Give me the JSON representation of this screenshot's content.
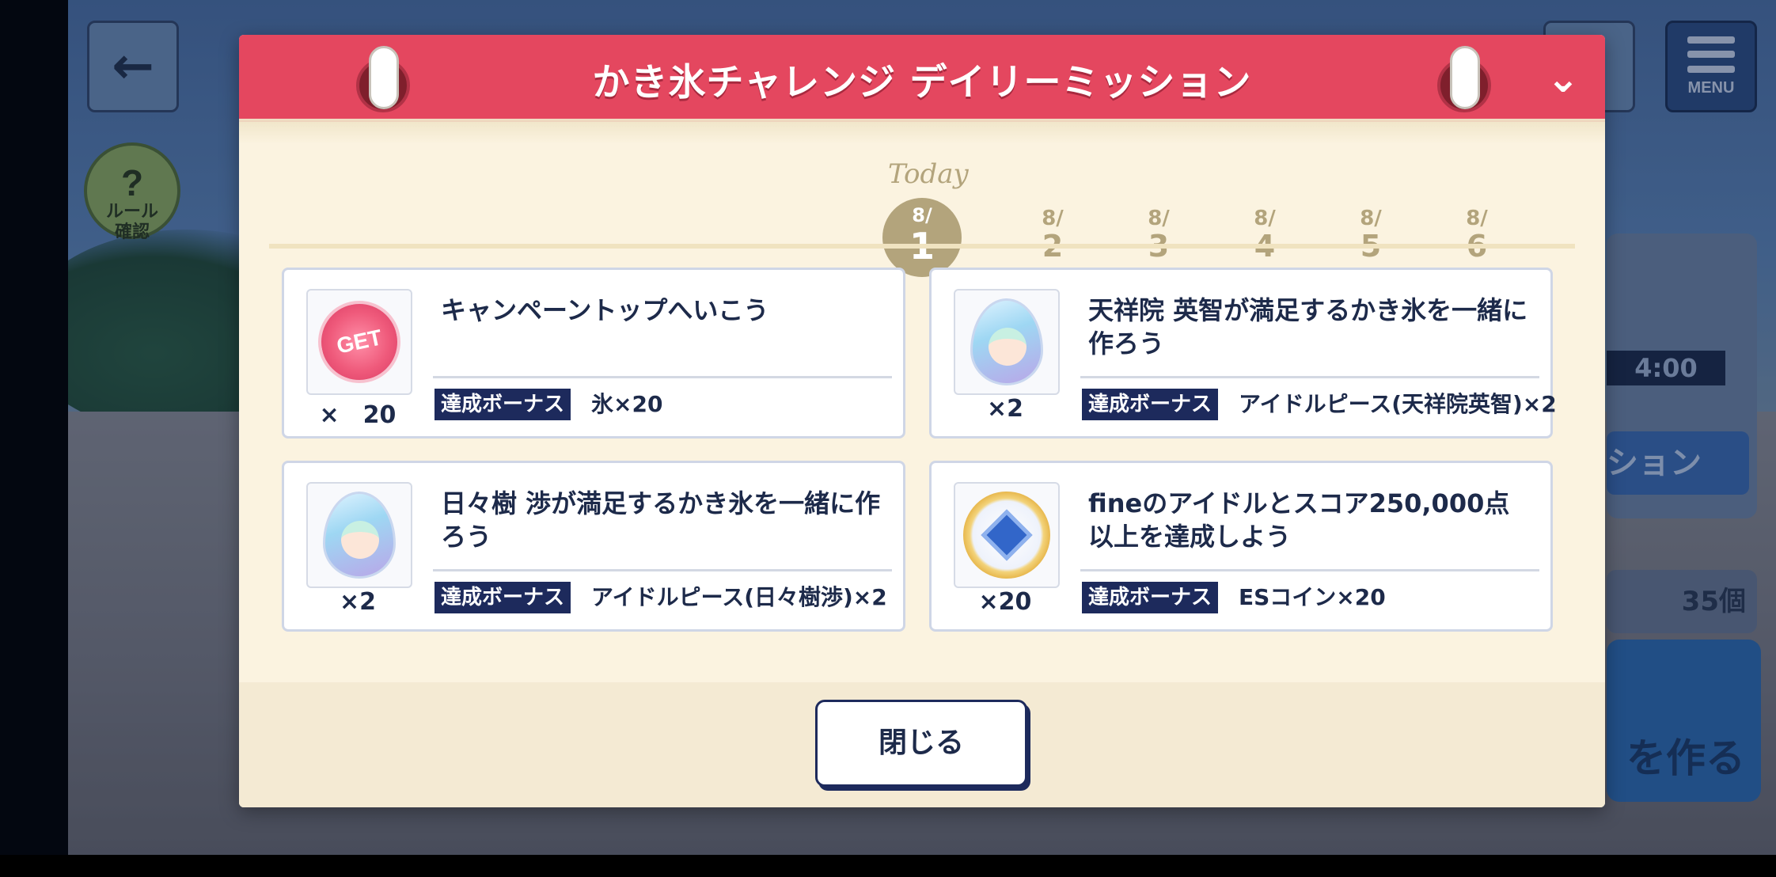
{
  "background": {
    "back_icon": "left-arrow-icon",
    "rule_button": {
      "icon": "question-icon",
      "label_line1": "ルール",
      "label_line2": "確認"
    },
    "menu_button": {
      "icon": "hamburger-icon",
      "label": "MENU"
    },
    "side_time": "4:00",
    "side_label": "ション",
    "side_count": "35個",
    "side_make_label": "を作る"
  },
  "dialog": {
    "title": "かき氷チャレンジ デイリーミッション",
    "collapse_icon": "chevron-down-icon",
    "today_label": "Today",
    "dates": [
      {
        "month": "8/",
        "day": "1",
        "today": true
      },
      {
        "month": "8/",
        "day": "2"
      },
      {
        "month": "8/",
        "day": "3"
      },
      {
        "month": "8/",
        "day": "4"
      },
      {
        "month": "8/",
        "day": "5"
      },
      {
        "month": "8/",
        "day": "6"
      }
    ],
    "missions": [
      {
        "icon": "get-ticket-icon",
        "icon_text": "GET",
        "quantity": "×　20",
        "title": "キャンペーントップへいこう",
        "bonus_tag": "達成ボーナス",
        "bonus": "氷×20"
      },
      {
        "icon": "idol-piece-eichi-icon",
        "quantity": "×2",
        "title": "天祥院 英智が満足するかき氷を一緒に作ろう",
        "bonus_tag": "達成ボーナス",
        "bonus": "アイドルピース(天祥院英智)×2"
      },
      {
        "icon": "idol-piece-wataru-icon",
        "quantity": "×2",
        "title": "日々樹 渉が満足するかき氷を一緒に作ろう",
        "bonus_tag": "達成ボーナス",
        "bonus": "アイドルピース(日々樹渉)×2"
      },
      {
        "icon": "es-coin-icon",
        "quantity": "×20",
        "title": "fineのアイドルとスコア250,000点以上を達成しよう",
        "bonus_tag": "達成ボーナス",
        "bonus": "ESコイン×20"
      }
    ],
    "close_label": "閉じる"
  },
  "colors": {
    "header": "#e4475f",
    "navy": "#1d2a5c",
    "gold": "#b3a47c",
    "cream": "#fbf3e0"
  }
}
